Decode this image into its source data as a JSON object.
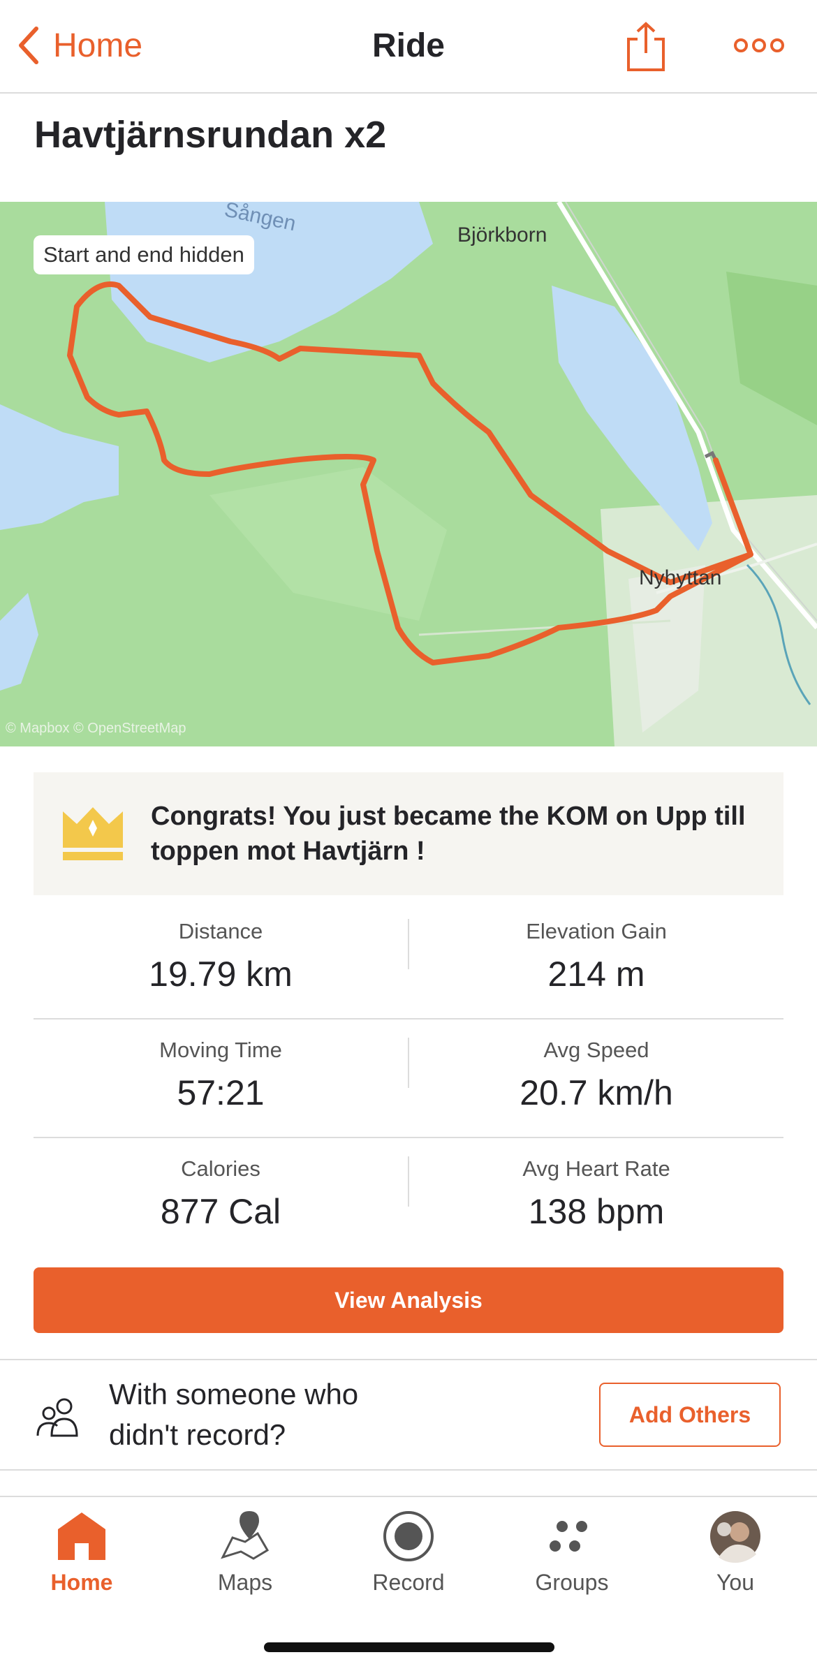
{
  "nav": {
    "back_label": "Home",
    "title": "Ride"
  },
  "activity": {
    "title": "Havtjärnsrundan x2"
  },
  "map": {
    "privacy_badge": "Start and end hidden",
    "attribution": "© Mapbox © OpenStreetMap",
    "place_labels": [
      "Björkborn",
      "Nyhyttan",
      "Sången"
    ],
    "route_color": "#e9602c"
  },
  "achievement": {
    "icon": "crown-icon",
    "text": "Congrats! You just became the KOM on Upp till toppen mot Havtjärn !"
  },
  "stats": [
    {
      "label": "Distance",
      "value": "19.79 km"
    },
    {
      "label": "Elevation Gain",
      "value": "214 m"
    },
    {
      "label": "Moving Time",
      "value": "57:21"
    },
    {
      "label": "Avg Speed",
      "value": "20.7 km/h"
    },
    {
      "label": "Calories",
      "value": "877 Cal"
    },
    {
      "label": "Avg Heart Rate",
      "value": "138 bpm"
    }
  ],
  "actions": {
    "view_analysis": "View Analysis"
  },
  "tag_others": {
    "prompt": "With someone who didn't record?",
    "button": "Add Others"
  },
  "tabbar": {
    "tabs": [
      {
        "label": "Home",
        "icon": "home-icon",
        "active": true
      },
      {
        "label": "Maps",
        "icon": "maps-icon",
        "active": false
      },
      {
        "label": "Record",
        "icon": "record-icon",
        "active": false
      },
      {
        "label": "Groups",
        "icon": "groups-icon",
        "active": false
      },
      {
        "label": "You",
        "icon": "avatar",
        "active": false
      }
    ]
  },
  "colors": {
    "accent": "#e9602c",
    "map_land": "#a9dc9d",
    "map_water": "#bfdcf6",
    "divider": "#dcdcdc"
  }
}
